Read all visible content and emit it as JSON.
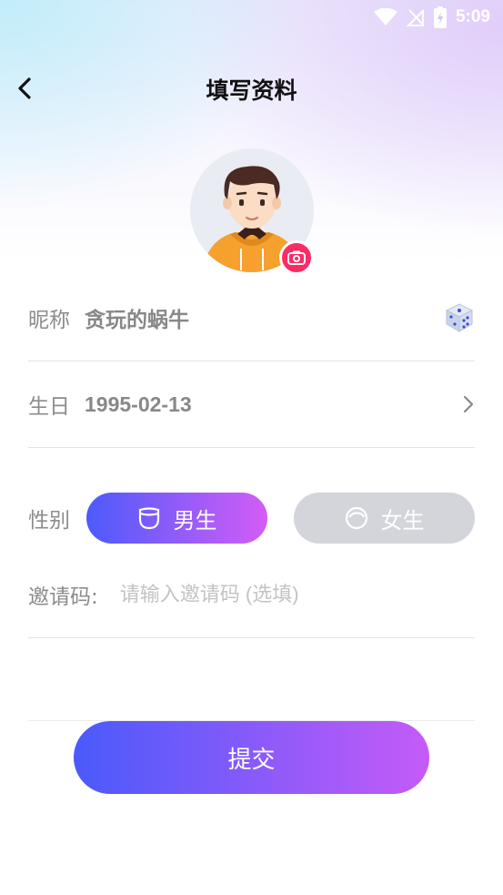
{
  "status_bar": {
    "time": "5:09"
  },
  "header": {
    "title": "填写资料"
  },
  "form": {
    "nickname": {
      "label": "昵称",
      "value": "贪玩的蜗牛"
    },
    "birthday": {
      "label": "生日",
      "value": "1995-02-13"
    },
    "gender": {
      "label": "性别",
      "male_label": "男生",
      "female_label": "女生",
      "selected": "男生"
    },
    "invite": {
      "label": "邀请码:",
      "placeholder": "请输入邀请码 (选填)",
      "value": ""
    }
  },
  "submit_label": "提交",
  "icons": {
    "back": "chevron-left-icon",
    "camera": "camera-icon",
    "dice": "dice-icon",
    "arrow": "chevron-right-icon",
    "male": "male-face-icon",
    "female": "female-face-icon",
    "wifi": "wifi-icon",
    "signal": "no-signal-icon",
    "battery": "battery-charging-icon"
  },
  "colors": {
    "accent_start": "#4c5bfb",
    "accent_end": "#d45cf7",
    "camera_badge": "#fb2b66",
    "unselected": "#d3d5da"
  }
}
